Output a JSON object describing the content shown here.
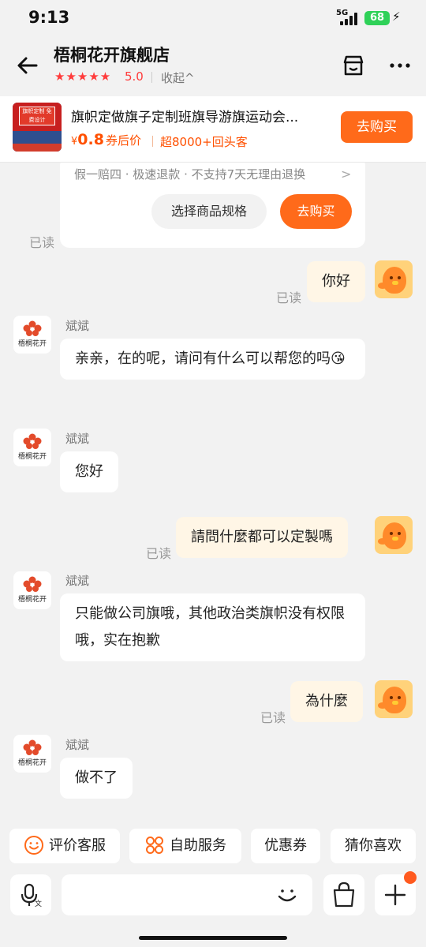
{
  "status_bar": {
    "time": "9:13",
    "network": "5G",
    "battery": "68"
  },
  "header": {
    "shop_name": "梧桐花开旗舰店",
    "stars": "★★★★★",
    "rating": "5.0",
    "collapse_label": "收起^"
  },
  "product": {
    "title": "旗帜定做旗子定制班旗导游旗运动会...",
    "currency": "¥",
    "price": "0.8",
    "price_note": "券后价",
    "repeat_customers": "超8000+回头客",
    "buy_label": "去购买",
    "thumb_text": "旗帜定制 免费设计"
  },
  "product_card": {
    "policy": "假一赔四 · 极速退款 · 不支持7天无理由退换",
    "spec_label": "选择商品规格",
    "buy_label": "去购买",
    "read": "已读"
  },
  "shop_avatar_text": "梧桐花开",
  "messages": [
    {
      "from": "me",
      "text": "你好",
      "read": "已读"
    },
    {
      "from": "shop",
      "name": "斌斌",
      "text": "亲亲，在的呢，请问有什么可以帮您的吗😘"
    },
    {
      "from": "shop",
      "name": "斌斌",
      "text": "您好"
    },
    {
      "from": "me",
      "text": "請問什麼都可以定製嗎",
      "read": "已读"
    },
    {
      "from": "shop",
      "name": "斌斌",
      "text": "只能做公司旗哦，其他政治类旗帜没有权限哦，实在抱歉"
    },
    {
      "from": "me",
      "text": "為什麼",
      "read": "已读"
    },
    {
      "from": "shop",
      "name": "斌斌",
      "text": "做不了"
    }
  ],
  "quick_actions": [
    "评价客服",
    "自助服务",
    "优惠券",
    "猜你喜欢"
  ],
  "colors": {
    "accent": "#ff6a1a",
    "price": "#ff5000",
    "my_bubble": "#fff6e6",
    "star": "#ff3b3b"
  },
  "icons": [
    "back-arrow-icon",
    "store-icon",
    "more-icon",
    "voice-icon",
    "emoji-icon",
    "bag-icon",
    "plus-icon"
  ]
}
